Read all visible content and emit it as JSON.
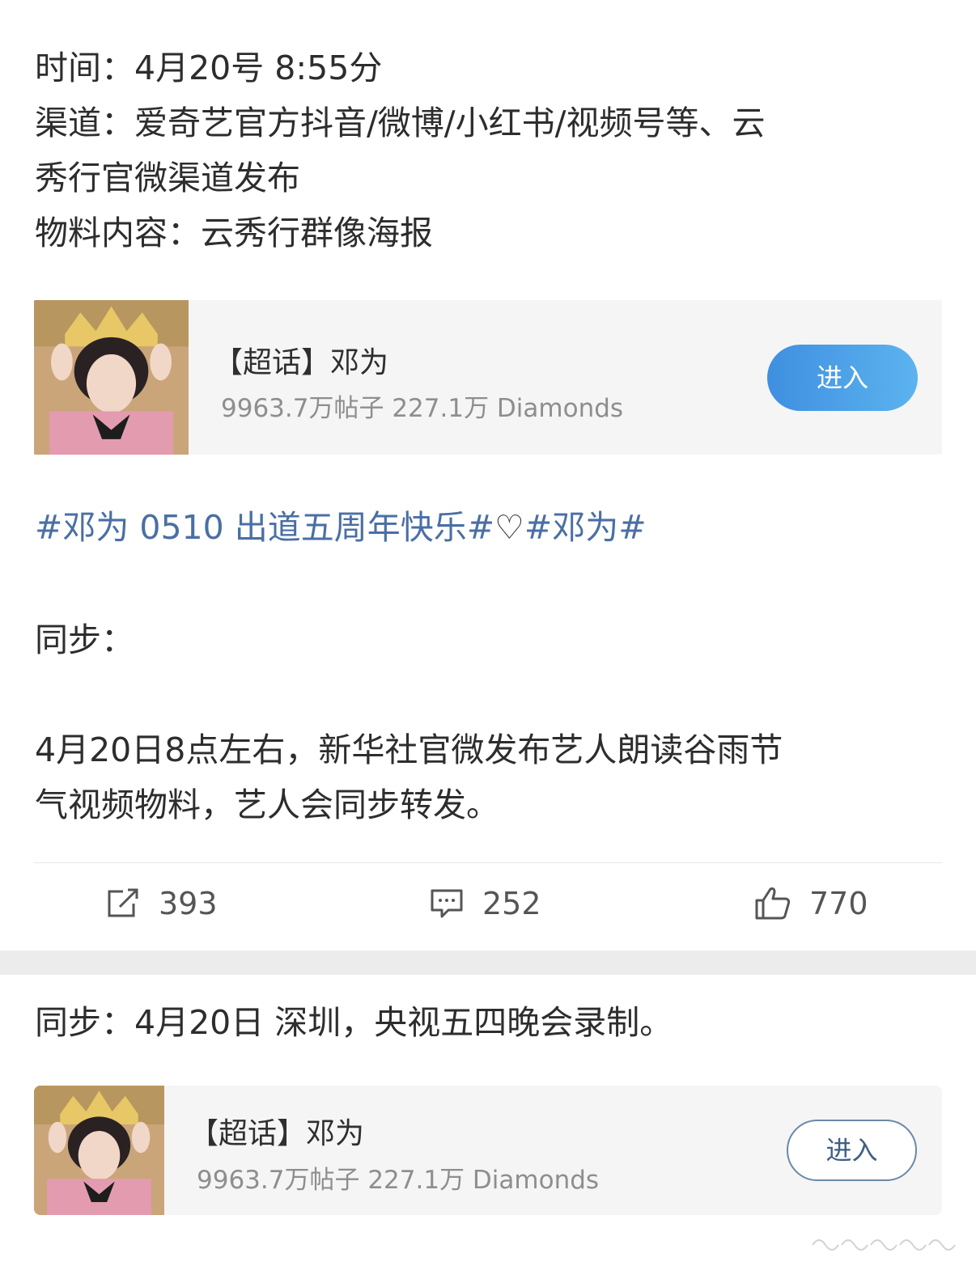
{
  "post1": {
    "info_lines": [
      "时间：4月20号 8:55分",
      "渠道：爱奇艺官方抖音/微博/小红书/视频号等、云",
      "秀行官微渠道发布",
      "物料内容：云秀行群像海报"
    ],
    "topic_card": {
      "title": "【超话】邓为",
      "stats": "9963.7万帖子 227.1万 Diamonds",
      "enter_label": "进入"
    },
    "hashtags": {
      "tag1": "#邓为 0510 出道五周年快乐#",
      "heart": "♡",
      "tag2": "#邓为#"
    },
    "sync_label": "同步：",
    "sync_lines": [
      "4月20日8点左右，新华社官微发布艺人朗读谷雨节",
      "气视频物料，艺人会同步转发。"
    ],
    "actions": {
      "repost_icon": "repost-icon",
      "repost_count": "393",
      "comment_icon": "comment-icon",
      "comment_count": "252",
      "like_icon": "like-icon",
      "like_count": "770"
    }
  },
  "post2": {
    "text": "同步：4月20日 深圳，央视五四晚会录制。",
    "topic_card": {
      "title": "【超话】邓为",
      "stats": "9963.7万帖子 227.1万 Diamonds",
      "enter_label": "进入"
    }
  },
  "colors": {
    "link": "#4a6fa5",
    "primary_button": "#3f8fe0",
    "card_bg": "#f5f5f5",
    "separator": "#ececec"
  }
}
